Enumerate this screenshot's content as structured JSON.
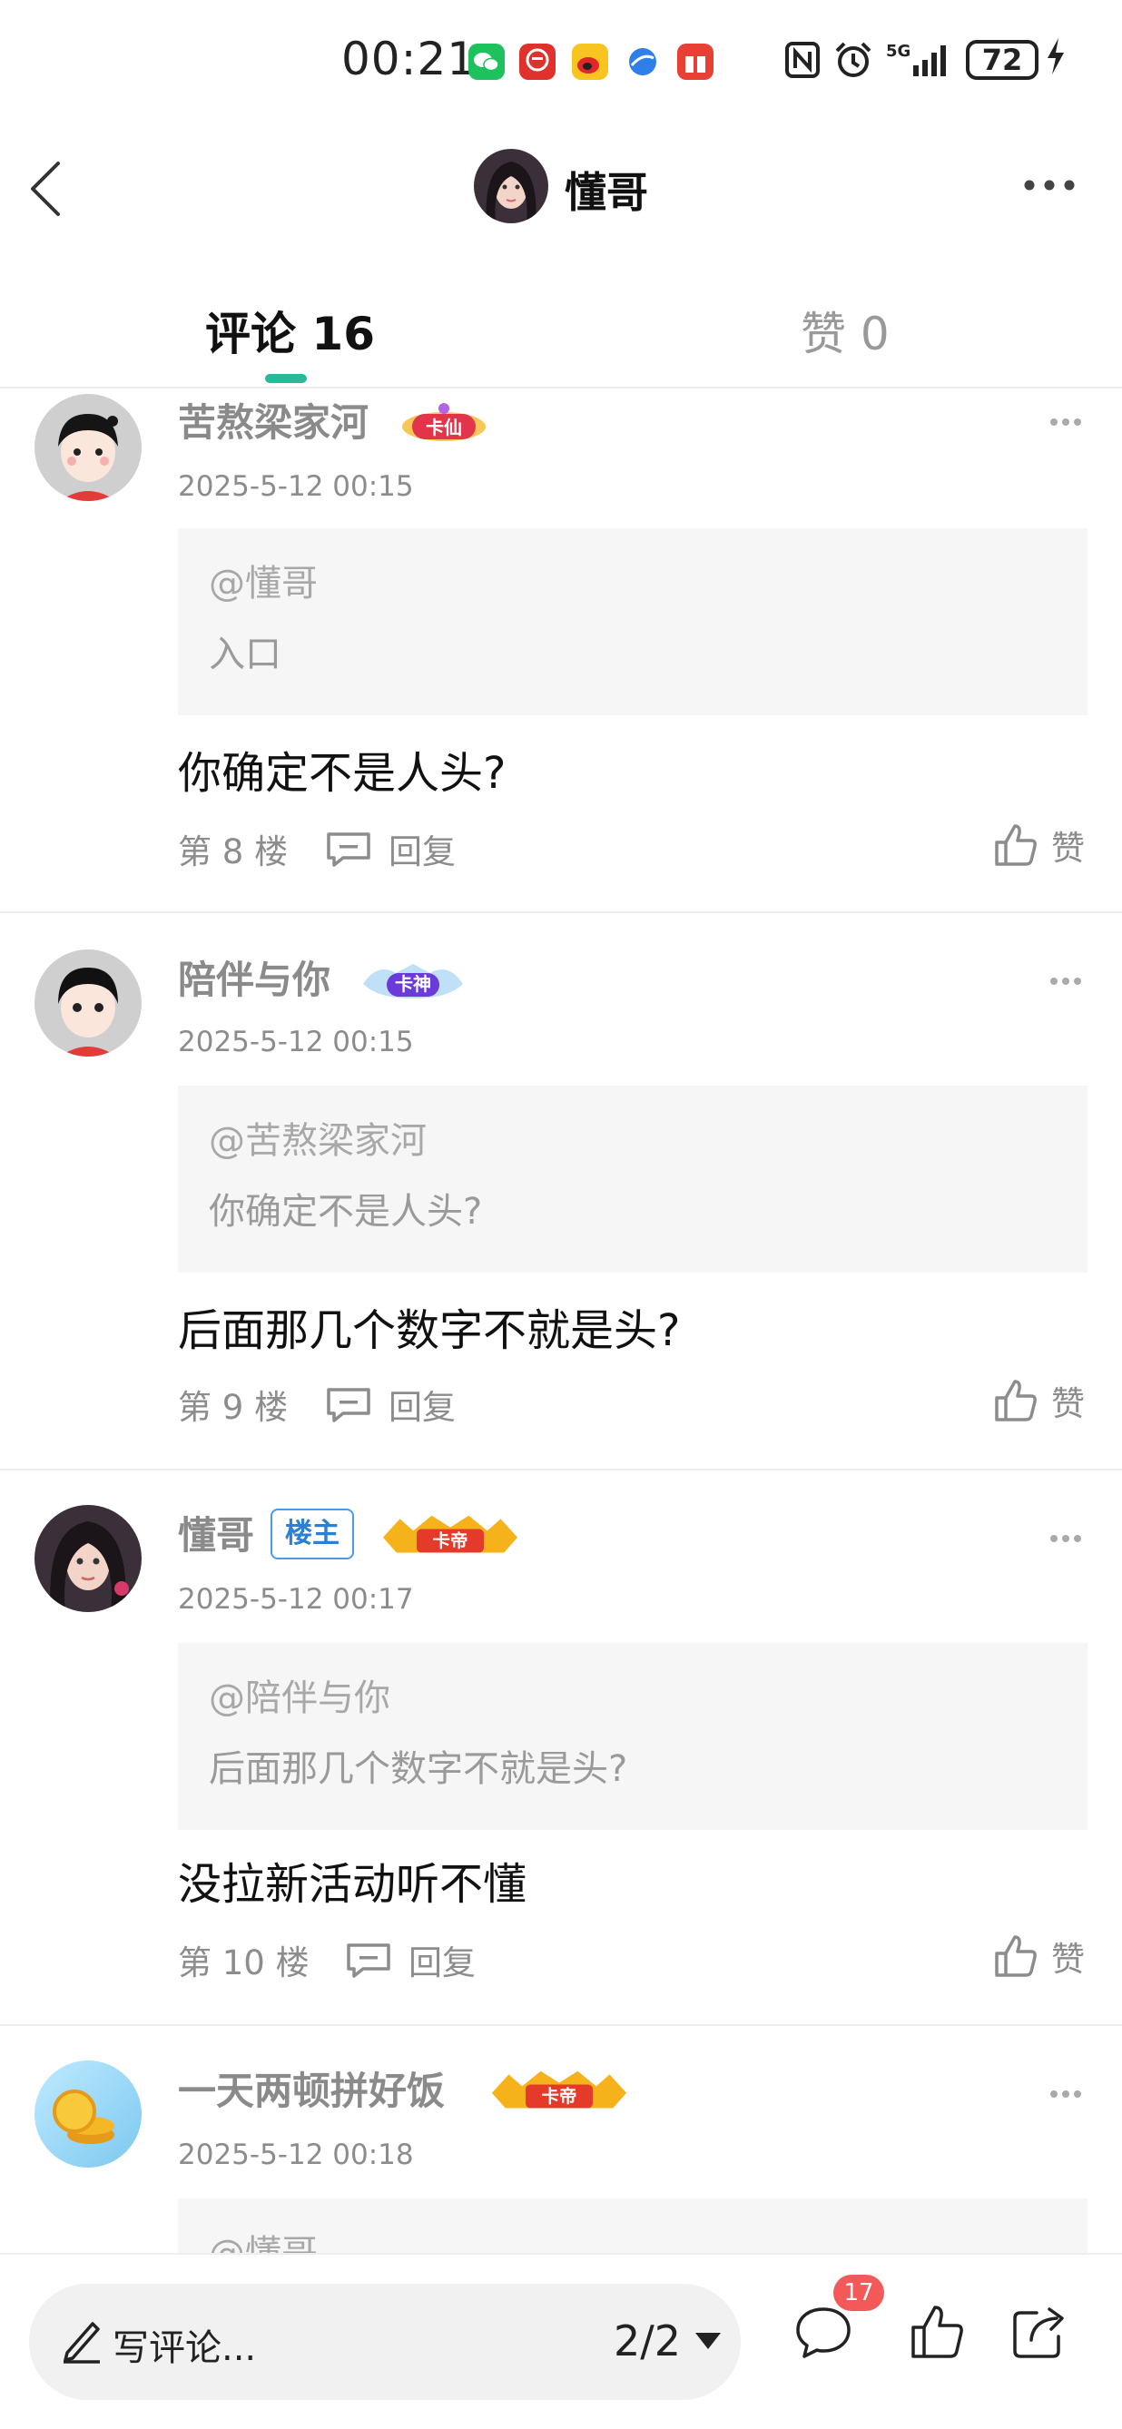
{
  "status_bar": {
    "time": "00:21",
    "battery": "72",
    "network": "5G",
    "apps": [
      "wechat-icon",
      "app-red-icon",
      "weibo-icon",
      "browser-icon",
      "app-gift-icon"
    ]
  },
  "header": {
    "title": "懂哥"
  },
  "tabs": {
    "comments_label": "评论 16",
    "likes_label": "赞 0"
  },
  "comments": [
    {
      "name": "苦熬梁家河",
      "badge": "卡仙",
      "time": "2025-5-12 00:15",
      "quote_user": "@懂哥",
      "quote_text": "入口",
      "text": "你确定不是人头?",
      "floor": "第 8 楼",
      "reply": "回复",
      "like": "赞"
    },
    {
      "name": "陪伴与你",
      "badge": "卡神",
      "time": "2025-5-12 00:15",
      "quote_user": "@苦熬梁家河",
      "quote_text": "你确定不是人头?",
      "text": "后面那几个数字不就是头?",
      "floor": "第 9 楼",
      "reply": "回复",
      "like": "赞"
    },
    {
      "name": "懂哥",
      "owner_tag": "楼主",
      "badge": "卡帝",
      "time": "2025-5-12 00:17",
      "quote_user": "@陪伴与你",
      "quote_text": "后面那几个数字不就是头?",
      "text": "没拉新活动听不懂",
      "floor": "第 10 楼",
      "reply": "回复",
      "like": "赞"
    },
    {
      "name": "一天两顿拼好饭",
      "badge": "卡帝",
      "time": "2025-5-12 00:18",
      "quote_user": "@懂哥"
    }
  ],
  "bottom_bar": {
    "placeholder": "写评论...",
    "page_indicator": "2/2",
    "comment_count": "17"
  },
  "colors": {
    "accent": "#28b89a",
    "owner_tag": "#2a7fd8",
    "count_badge": "#f25a5a"
  }
}
